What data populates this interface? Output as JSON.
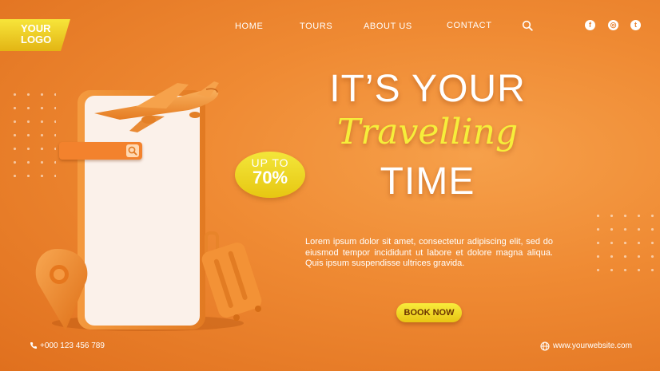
{
  "logo": {
    "line1": "YOUR",
    "line2": "LOGO"
  },
  "nav": {
    "items": [
      "HOME",
      "TOURS",
      "ABOUT US",
      "CONTACT"
    ]
  },
  "icons": {
    "search": "search-icon",
    "social": [
      "facebook-icon",
      "instagram-icon",
      "twitter-icon"
    ],
    "phone": "phone-icon",
    "globe": "globe-icon"
  },
  "social": {
    "facebook": "f",
    "instagram": "◎",
    "twitter": "t"
  },
  "badge": {
    "top": "UP TO",
    "value": "70%"
  },
  "headline": {
    "line1": "IT’S YOUR",
    "line2": "Travelling",
    "line3": "TIME"
  },
  "body": "Lorem ipsum dolor sit amet, consectetur adipiscing elit, sed do eiusmod tempor incididunt ut labore et dolore magna aliqua. Quis ipsum suspendisse ultrices gravida.",
  "cta": {
    "label": "BOOK NOW"
  },
  "footer": {
    "phone": "+000 123 456 789",
    "website": "www.yourwebsite.com"
  },
  "colors": {
    "background": "#ef8a33",
    "accent_yellow": "#f6ee3a",
    "text": "#ffffff"
  }
}
